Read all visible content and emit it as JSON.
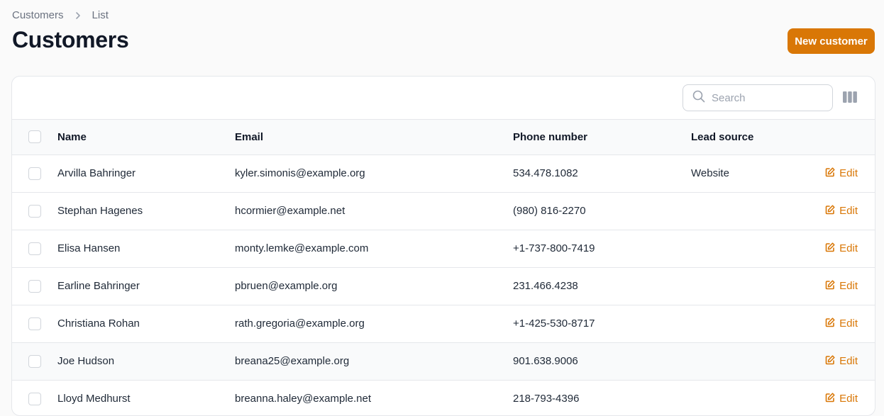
{
  "breadcrumb": {
    "items": [
      "Customers",
      "List"
    ]
  },
  "header": {
    "title": "Customers",
    "new_button": "New customer"
  },
  "colors": {
    "accent": "#d97706",
    "border": "#e5e7eb",
    "muted": "#6b7280"
  },
  "toolbar": {
    "search_placeholder": "Search",
    "search_icon": "search-icon",
    "columns_icon": "columns-icon"
  },
  "table": {
    "columns": [
      "Name",
      "Email",
      "Phone number",
      "Lead source"
    ],
    "action_label": "Edit",
    "rows": [
      {
        "name": "Arvilla Bahringer",
        "email": "kyler.simonis@example.org",
        "phone": "534.478.1082",
        "lead_source": "Website"
      },
      {
        "name": "Stephan Hagenes",
        "email": "hcormier@example.net",
        "phone": "(980) 816-2270",
        "lead_source": ""
      },
      {
        "name": "Elisa Hansen",
        "email": "monty.lemke@example.com",
        "phone": "+1-737-800-7419",
        "lead_source": ""
      },
      {
        "name": "Earline Bahringer",
        "email": "pbruen@example.org",
        "phone": "231.466.4238",
        "lead_source": ""
      },
      {
        "name": "Christiana Rohan",
        "email": "rath.gregoria@example.org",
        "phone": "+1-425-530-8717",
        "lead_source": ""
      },
      {
        "name": "Joe Hudson",
        "email": "breana25@example.org",
        "phone": "901.638.9006",
        "lead_source": ""
      },
      {
        "name": "Lloyd Medhurst",
        "email": "breanna.haley@example.net",
        "phone": "218-793-4396",
        "lead_source": ""
      }
    ]
  }
}
